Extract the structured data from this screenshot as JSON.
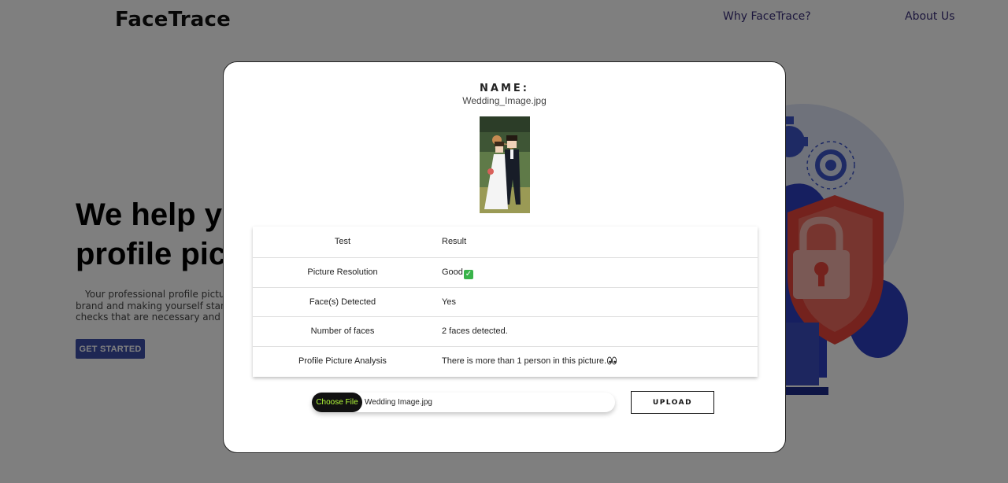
{
  "brand": {
    "name": "FaceTrace"
  },
  "nav": {
    "items": [
      "Why FaceTrace?",
      "About Us"
    ]
  },
  "hero": {
    "title_line1": "We help you",
    "title_line2": "profile picture",
    "text_line1": "Your professional profile picture",
    "text_line2": "brand and making yourself stand",
    "text_line3": "checks that are necessary and give",
    "cta_label": "GET STARTED"
  },
  "modal": {
    "name_label": "NAME:",
    "file_name": "Wedding_Image.jpg",
    "table": {
      "headers": [
        "Test",
        "Result"
      ],
      "rows": [
        {
          "test": "Picture Resolution",
          "result": "Good",
          "icon": "check-mark-icon"
        },
        {
          "test": "Face(s) Detected",
          "result": "Yes"
        },
        {
          "test": "Number of faces",
          "result": "2 faces detected."
        },
        {
          "test": "Profile Picture Analysis",
          "result": "There is more than 1 person in this picture.",
          "icon": "eyes-icon"
        }
      ]
    },
    "file_input": {
      "button_label": "Choose File",
      "chosen_file": "Wedding Image.jpg"
    },
    "upload_label": "UPLOAD"
  },
  "colors": {
    "accent": "#3d4fa8",
    "nav": "#3a2f7a",
    "good": "#39b34a",
    "choose_text": "#b6ff3a",
    "shield": "#e8453a"
  }
}
